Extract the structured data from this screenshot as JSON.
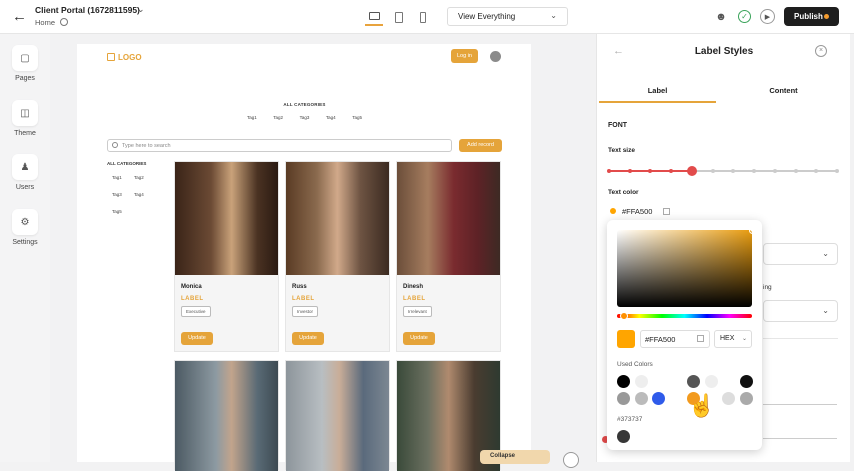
{
  "header": {
    "project_title": "Client Portal (1672811595)",
    "page_name": "Home",
    "view_select": "View Everything",
    "publish_label": "Publish"
  },
  "sidebar": {
    "items": [
      {
        "label": "Pages",
        "icon": "pages-icon"
      },
      {
        "label": "Theme",
        "icon": "theme-icon"
      },
      {
        "label": "Users",
        "icon": "users-icon"
      },
      {
        "label": "Settings",
        "icon": "settings-icon"
      }
    ]
  },
  "canvas": {
    "logo": "LOGO",
    "login": "Log in",
    "all_categories": "ALL CATEGORIES",
    "tags": [
      "Tag1",
      "Tag2",
      "Tag3",
      "Tag4",
      "Tag5"
    ],
    "search_placeholder": "Type here to search",
    "add_record": "Add record",
    "category_title": "ALL CATEGORIES",
    "category_tags": [
      "Tag1",
      "Tag2",
      "Tag3",
      "Tag4",
      "Tag5"
    ],
    "cards": [
      {
        "name": "Monica",
        "label": "LABEL",
        "role": "Executive",
        "button": "Update"
      },
      {
        "name": "Russ",
        "label": "LABEL",
        "role": "Investor",
        "button": "Update"
      },
      {
        "name": "Dinesh",
        "label": "LABEL",
        "role": "Irrelevant",
        "button": "Update"
      }
    ],
    "floating_label": "Collapse"
  },
  "panel": {
    "title": "Label Styles",
    "tabs": [
      "Label",
      "Content"
    ],
    "font_section": "FONT",
    "text_size_label": "Text size",
    "text_size_level": 4,
    "text_size_steps": 12,
    "text_color_label": "Text color",
    "text_color_value": "#FFA500",
    "partial_label": "ing"
  },
  "color_picker": {
    "hex_value": "#FFA500",
    "format": "HEX",
    "used_colors_label": "Used Colors",
    "used_colors": [
      "#000000",
      "#eeeeee",
      "#ffffff",
      "#ffffff",
      "#555555",
      "#eeeeee",
      "#ffffff",
      "#111111",
      "#999999",
      "#bbbbbb",
      "#2f5bea",
      "#ffffff",
      "#f29a1e",
      "#ffffff",
      "#dddddd",
      "#aaaaaa"
    ],
    "custom_label": "#373737",
    "custom_color": "#373737"
  },
  "colors": {
    "accent": "#e5a43a",
    "slider_active": "#e24b4b",
    "text_color_swatch": "#FFA500"
  }
}
